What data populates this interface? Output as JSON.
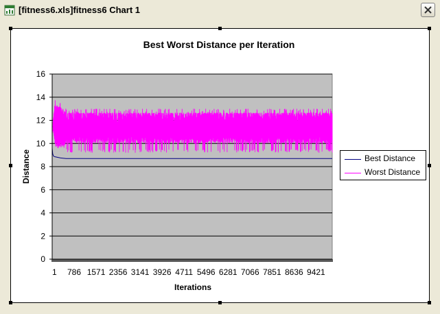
{
  "window": {
    "title": "[fitness6.xls]fitness6 Chart 1",
    "icon": "excel-chart-icon",
    "close_icon": "close-icon"
  },
  "colors": {
    "window_bg": "#ece9d8",
    "plot_bg": "#c0c0c0",
    "best": "#000080",
    "worst": "#ff00ff"
  },
  "chart_data": {
    "type": "line",
    "title": "Best Worst Distance per Iteration",
    "xlabel": "Iterations",
    "ylabel": "Distance",
    "ylim": [
      0,
      16
    ],
    "yticks": [
      0,
      2,
      4,
      6,
      8,
      10,
      12,
      14,
      16
    ],
    "x_tick_labels": [
      "1",
      "786",
      "1571",
      "2356",
      "3141",
      "3926",
      "4711",
      "5496",
      "6281",
      "7066",
      "7851",
      "8636",
      "9421"
    ],
    "x_range": [
      1,
      10000
    ],
    "grid": "horizontal",
    "legend_position": "right",
    "series": [
      {
        "name": "Best Distance",
        "color": "#000080",
        "x": [
          1,
          20,
          50,
          100,
          200,
          300,
          500,
          1000,
          10000
        ],
        "values": [
          9.6,
          9.1,
          8.9,
          8.85,
          8.8,
          8.75,
          8.7,
          8.7,
          8.7
        ]
      },
      {
        "name": "Worst Distance",
        "color": "#ff00ff",
        "x": [
          1,
          50,
          100,
          200,
          300,
          400,
          500,
          1000,
          10000
        ],
        "upper": [
          11.5,
          12.8,
          13.8,
          13.6,
          13.5,
          13.3,
          13.0,
          13.0,
          13.0
        ],
        "typical_low": [
          11.0,
          10.8,
          10.0,
          9.6,
          9.6,
          9.6,
          10.0,
          10.0,
          10.0
        ],
        "lower": [
          11.0,
          10.5,
          9.6,
          9.5,
          9.5,
          9.5,
          9.2,
          9.2,
          9.2
        ]
      }
    ]
  }
}
